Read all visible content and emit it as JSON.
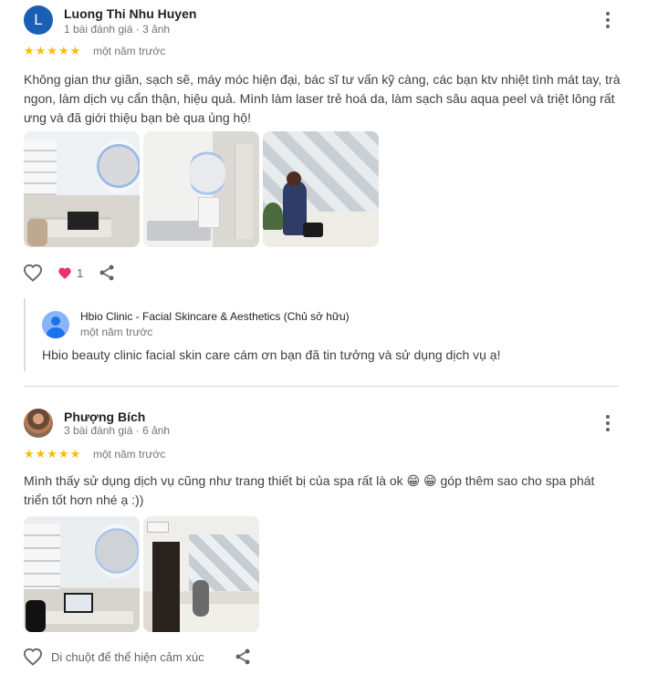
{
  "reviews": [
    {
      "avatar_letter": "L",
      "name": "Luong Thi Nhu Huyen",
      "meta": "1 bài đánh giá · 3 ảnh",
      "stars": "★★★★★",
      "rating": 5,
      "time": "một năm trước",
      "text": "Không gian thư giãn, sạch sẽ, máy móc hiện đại, bác sĩ tư vấn kỹ càng, các bạn ktv nhiệt tình mát tay, trà ngon, làm dịch vụ cẩn thận, hiệu quả. Mình làm laser trẻ hoá da, làm sạch sâu aqua peel và triệt lông rất ưng và đã giới thiệu bạn bè qua ủng hộ!",
      "reaction_count": "1",
      "reply": {
        "owner": "Hbio Clinic - Facial Skincare & Aesthetics (Chủ sở hữu)",
        "time": "một năm trước",
        "text": "Hbio beauty clinic facial skin care cám ơn bạn đã tin tưởng và sử dụng dịch vụ ạ!"
      }
    },
    {
      "name": "Phượng Bích",
      "meta": "3 bài đánh giá · 6 ảnh",
      "stars": "★★★★★",
      "rating": 5,
      "time": "một năm trước",
      "text": "Mình thấy sử dụng dịch vụ cũng như trang thiết bị của spa rất là ok 😁 😁 góp thêm sao cho spa phát triển tốt hơn nhé ạ :))",
      "hint": "Di chuột để thể hiện cảm xúc"
    }
  ],
  "colors": {
    "star": "#fbbc04",
    "heart_active": "#e8336d",
    "avatar_letter_bg": "#1a5fb4"
  },
  "icons": [
    "more-vert-icon",
    "heart-outline-icon",
    "heart-filled-icon",
    "share-icon",
    "avatar-placeholder-icon"
  ]
}
